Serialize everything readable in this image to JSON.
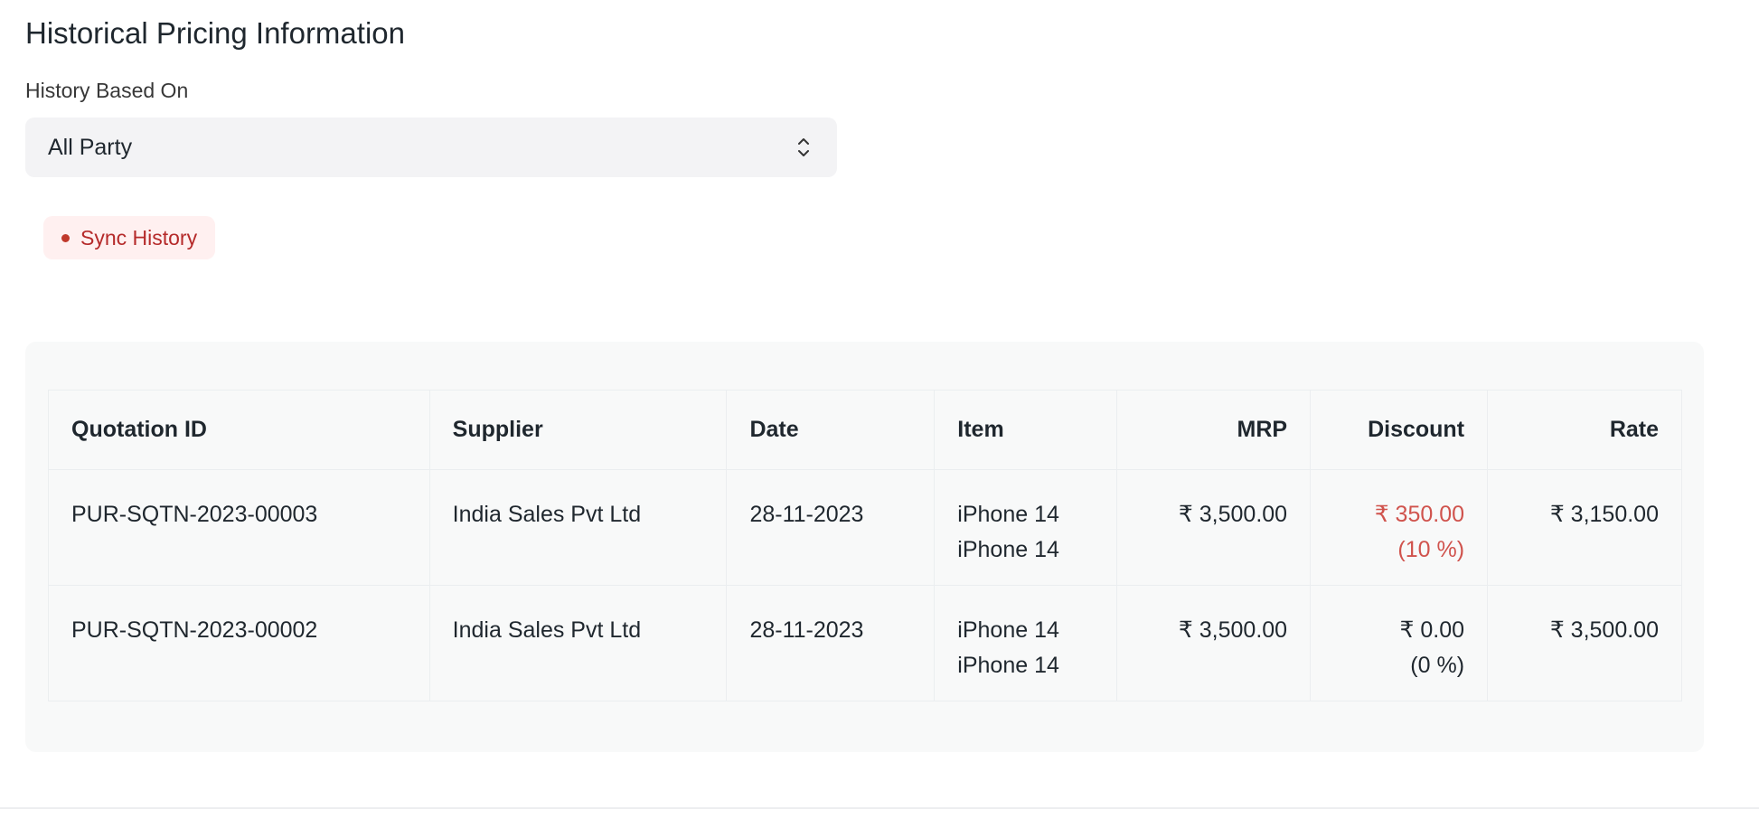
{
  "section": {
    "title": "Historical Pricing Information",
    "history_label": "History Based On",
    "history_value": "All Party",
    "sync_button": "Sync History"
  },
  "table": {
    "headers": {
      "quotation_id": "Quotation ID",
      "supplier": "Supplier",
      "date": "Date",
      "item": "Item",
      "mrp": "MRP",
      "discount": "Discount",
      "rate": "Rate"
    },
    "rows": [
      {
        "quotation_id": "PUR-SQTN-2023-00003",
        "supplier": "India Sales Pvt Ltd",
        "date": "28-11-2023",
        "items": [
          "iPhone 14",
          "iPhone 14"
        ],
        "mrp": "₹ 3,500.00",
        "discount_amount": "₹ 350.00",
        "discount_percent": "(10 %)",
        "rate": "₹ 3,150.00"
      },
      {
        "quotation_id": "PUR-SQTN-2023-00002",
        "supplier": "India Sales Pvt Ltd",
        "date": "28-11-2023",
        "items": [
          "iPhone 14",
          "iPhone 14"
        ],
        "mrp": "₹ 3,500.00",
        "discount_amount": "₹ 0.00",
        "discount_percent": "(0 %)",
        "rate": "₹ 3,500.00"
      }
    ]
  },
  "colors": {
    "discount_highlight": "#d0534d",
    "sync_button_bg": "#fff0f0",
    "sync_button_text": "#b52a2a"
  },
  "icons": {
    "select_chevron": "chevron-up-down-icon",
    "sync_status": "dot-icon"
  }
}
